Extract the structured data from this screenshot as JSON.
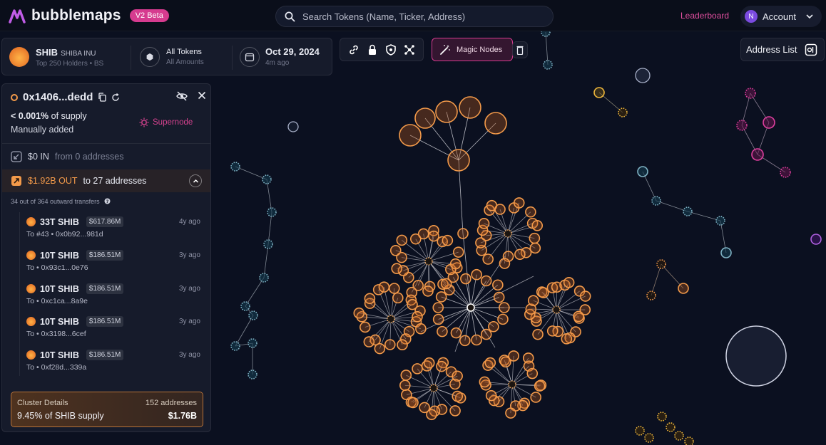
{
  "app": {
    "logo_text": "bubblemaps",
    "version_badge": "V2 Beta",
    "leaderboard_label": "Leaderboard",
    "account_label": "Account",
    "account_initial": "N"
  },
  "search": {
    "placeholder": "Search Tokens (Name, Ticker, Address)"
  },
  "token": {
    "ticker": "SHIB",
    "name": "SHIBA INU",
    "holders": "Top 250 Holders • BS",
    "filter_title": "All Tokens",
    "filter_sub": "All Amounts",
    "date": "Oct 29, 2024",
    "date_ago": "4m ago"
  },
  "toolbar": {
    "magic_nodes_label": "Magic Nodes",
    "address_list_label": "Address List"
  },
  "side_panel": {
    "address": "0x1406...dedd",
    "supply_share": "< 0.001%",
    "supply_suffix": "of supply",
    "added": "Manually added",
    "supernode_label": "Supernode",
    "in_value": "$0 IN",
    "in_from": "from 0 addresses",
    "out_value": "$1.92B OUT",
    "out_to": "to 27 addresses",
    "transfers_note": "34 out of 364 outward transfers",
    "transfers": [
      {
        "amount": "33T SHIB",
        "usd": "$617.86M",
        "ago": "4y ago",
        "to": "To #43 • 0x0b92...981d"
      },
      {
        "amount": "10T SHIB",
        "usd": "$186.51M",
        "ago": "3y ago",
        "to": "To  • 0x93c1...0e76"
      },
      {
        "amount": "10T SHIB",
        "usd": "$186.51M",
        "ago": "3y ago",
        "to": "To  • 0xc1ca...8a9e"
      },
      {
        "amount": "10T SHIB",
        "usd": "$186.51M",
        "ago": "3y ago",
        "to": "To  • 0x3198...6cef"
      },
      {
        "amount": "10T SHIB",
        "usd": "$186.51M",
        "ago": "3y ago",
        "to": "To  • 0xf28d...339a"
      }
    ],
    "cluster": {
      "title": "Cluster Details",
      "count": "152 addresses",
      "supply": "9.45% of SHIB supply",
      "value": "$1.76B"
    }
  },
  "colors": {
    "accent_pink": "#d63b8f",
    "node_orange": "#f39a4a",
    "node_teal": "#7fb2c4",
    "node_magenta": "#e0409f",
    "node_gold": "#f0b83c"
  }
}
